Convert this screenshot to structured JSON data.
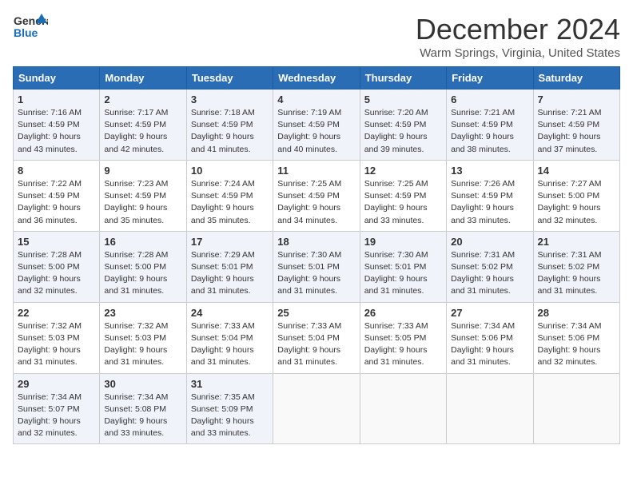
{
  "logo": {
    "text_general": "General",
    "text_blue": "Blue"
  },
  "header": {
    "month": "December 2024",
    "location": "Warm Springs, Virginia, United States"
  },
  "weekdays": [
    "Sunday",
    "Monday",
    "Tuesday",
    "Wednesday",
    "Thursday",
    "Friday",
    "Saturday"
  ],
  "weeks": [
    [
      {
        "day": "1",
        "sunrise": "7:16 AM",
        "sunset": "4:59 PM",
        "daylight": "9 hours and 43 minutes."
      },
      {
        "day": "2",
        "sunrise": "7:17 AM",
        "sunset": "4:59 PM",
        "daylight": "9 hours and 42 minutes."
      },
      {
        "day": "3",
        "sunrise": "7:18 AM",
        "sunset": "4:59 PM",
        "daylight": "9 hours and 41 minutes."
      },
      {
        "day": "4",
        "sunrise": "7:19 AM",
        "sunset": "4:59 PM",
        "daylight": "9 hours and 40 minutes."
      },
      {
        "day": "5",
        "sunrise": "7:20 AM",
        "sunset": "4:59 PM",
        "daylight": "9 hours and 39 minutes."
      },
      {
        "day": "6",
        "sunrise": "7:21 AM",
        "sunset": "4:59 PM",
        "daylight": "9 hours and 38 minutes."
      },
      {
        "day": "7",
        "sunrise": "7:21 AM",
        "sunset": "4:59 PM",
        "daylight": "9 hours and 37 minutes."
      }
    ],
    [
      {
        "day": "8",
        "sunrise": "7:22 AM",
        "sunset": "4:59 PM",
        "daylight": "9 hours and 36 minutes."
      },
      {
        "day": "9",
        "sunrise": "7:23 AM",
        "sunset": "4:59 PM",
        "daylight": "9 hours and 35 minutes."
      },
      {
        "day": "10",
        "sunrise": "7:24 AM",
        "sunset": "4:59 PM",
        "daylight": "9 hours and 35 minutes."
      },
      {
        "day": "11",
        "sunrise": "7:25 AM",
        "sunset": "4:59 PM",
        "daylight": "9 hours and 34 minutes."
      },
      {
        "day": "12",
        "sunrise": "7:25 AM",
        "sunset": "4:59 PM",
        "daylight": "9 hours and 33 minutes."
      },
      {
        "day": "13",
        "sunrise": "7:26 AM",
        "sunset": "4:59 PM",
        "daylight": "9 hours and 33 minutes."
      },
      {
        "day": "14",
        "sunrise": "7:27 AM",
        "sunset": "5:00 PM",
        "daylight": "9 hours and 32 minutes."
      }
    ],
    [
      {
        "day": "15",
        "sunrise": "7:28 AM",
        "sunset": "5:00 PM",
        "daylight": "9 hours and 32 minutes."
      },
      {
        "day": "16",
        "sunrise": "7:28 AM",
        "sunset": "5:00 PM",
        "daylight": "9 hours and 31 minutes."
      },
      {
        "day": "17",
        "sunrise": "7:29 AM",
        "sunset": "5:01 PM",
        "daylight": "9 hours and 31 minutes."
      },
      {
        "day": "18",
        "sunrise": "7:30 AM",
        "sunset": "5:01 PM",
        "daylight": "9 hours and 31 minutes."
      },
      {
        "day": "19",
        "sunrise": "7:30 AM",
        "sunset": "5:01 PM",
        "daylight": "9 hours and 31 minutes."
      },
      {
        "day": "20",
        "sunrise": "7:31 AM",
        "sunset": "5:02 PM",
        "daylight": "9 hours and 31 minutes."
      },
      {
        "day": "21",
        "sunrise": "7:31 AM",
        "sunset": "5:02 PM",
        "daylight": "9 hours and 31 minutes."
      }
    ],
    [
      {
        "day": "22",
        "sunrise": "7:32 AM",
        "sunset": "5:03 PM",
        "daylight": "9 hours and 31 minutes."
      },
      {
        "day": "23",
        "sunrise": "7:32 AM",
        "sunset": "5:03 PM",
        "daylight": "9 hours and 31 minutes."
      },
      {
        "day": "24",
        "sunrise": "7:33 AM",
        "sunset": "5:04 PM",
        "daylight": "9 hours and 31 minutes."
      },
      {
        "day": "25",
        "sunrise": "7:33 AM",
        "sunset": "5:04 PM",
        "daylight": "9 hours and 31 minutes."
      },
      {
        "day": "26",
        "sunrise": "7:33 AM",
        "sunset": "5:05 PM",
        "daylight": "9 hours and 31 minutes."
      },
      {
        "day": "27",
        "sunrise": "7:34 AM",
        "sunset": "5:06 PM",
        "daylight": "9 hours and 31 minutes."
      },
      {
        "day": "28",
        "sunrise": "7:34 AM",
        "sunset": "5:06 PM",
        "daylight": "9 hours and 32 minutes."
      }
    ],
    [
      {
        "day": "29",
        "sunrise": "7:34 AM",
        "sunset": "5:07 PM",
        "daylight": "9 hours and 32 minutes."
      },
      {
        "day": "30",
        "sunrise": "7:34 AM",
        "sunset": "5:08 PM",
        "daylight": "9 hours and 33 minutes."
      },
      {
        "day": "31",
        "sunrise": "7:35 AM",
        "sunset": "5:09 PM",
        "daylight": "9 hours and 33 minutes."
      },
      null,
      null,
      null,
      null
    ]
  ]
}
